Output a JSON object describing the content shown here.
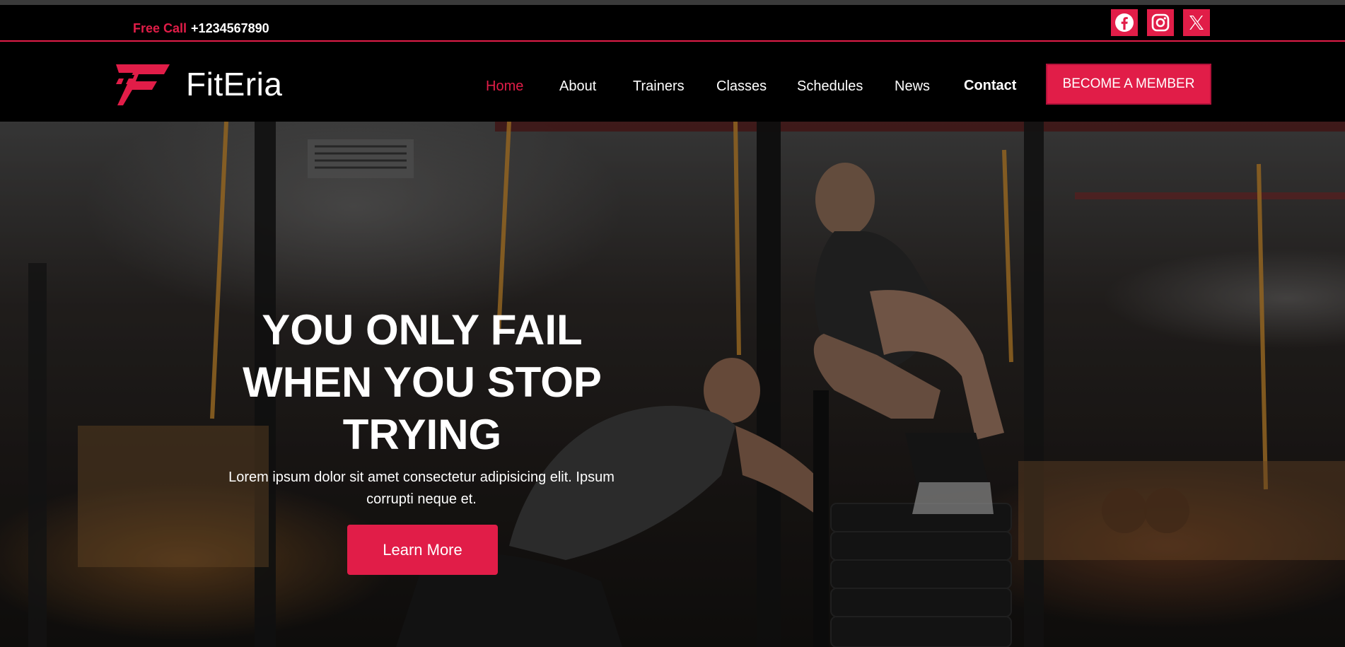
{
  "topbar": {
    "free_call_label": "Free Call",
    "phone": "+1234567890",
    "social": [
      "facebook-icon",
      "instagram-icon",
      "x-icon"
    ]
  },
  "brand": {
    "name": "FitEria",
    "logo": "logo-f-mark"
  },
  "nav": {
    "items": [
      "Home",
      "About",
      "Trainers",
      "Classes",
      "Schedules",
      "News",
      "Contact"
    ],
    "active": "Home",
    "cta": "BECOME A MEMBER"
  },
  "hero": {
    "title_line1": "YOU ONLY FAIL",
    "title_line2": "WHEN YOU STOP",
    "title_line3": "TRYING",
    "subtitle": "Lorem ipsum dolor sit amet consectetur adipisicing elit. Ipsum corrupti neque et.",
    "button": "Learn More"
  },
  "colors": {
    "accent": "#e11d48",
    "background": "#000000",
    "text": "#ffffff"
  }
}
